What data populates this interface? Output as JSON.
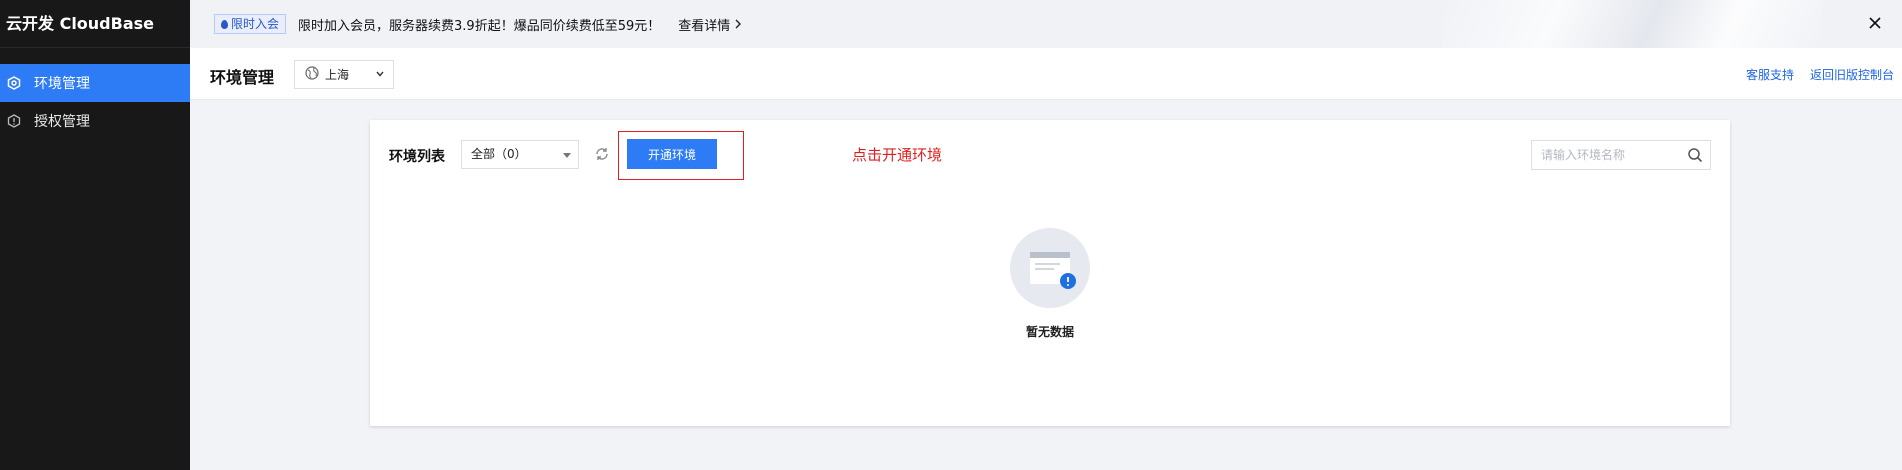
{
  "app": {
    "brand": "云开发 CloudBase"
  },
  "sidebar": {
    "items": [
      {
        "label": "环境管理",
        "icon": "hexagon-settings-icon",
        "active": true
      },
      {
        "label": "授权管理",
        "icon": "shield-auth-icon",
        "active": false
      }
    ]
  },
  "banner": {
    "badge": "限时入会",
    "text": "限时加入会员，服务器续费3.9折起！爆品同价续费低至59元！",
    "link": "查看详情"
  },
  "header": {
    "title": "环境管理",
    "region": "上海",
    "links": [
      "客服支持",
      "返回旧版控制台"
    ]
  },
  "card": {
    "list_label": "环境列表",
    "filter_value": "全部（0）",
    "primary_button": "开通环境",
    "hint": "点击开通环境",
    "search_placeholder": "请输入环境名称",
    "empty_text": "暂无数据"
  },
  "colors": {
    "accent": "#2d7cf5",
    "sidebar_bg": "#181818",
    "annotation": "#e02020"
  }
}
